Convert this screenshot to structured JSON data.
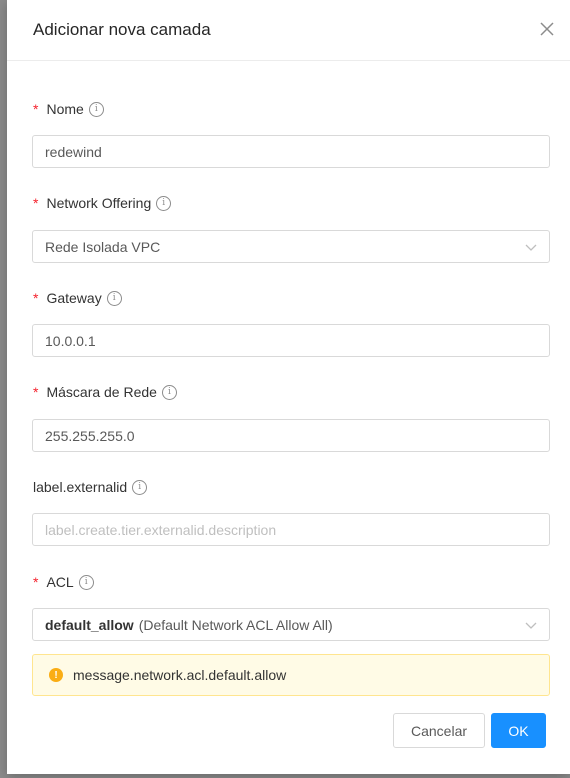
{
  "modal": {
    "title": "Adicionar nova camada",
    "close_icon": "close-icon"
  },
  "fields": {
    "name": {
      "label": "Nome",
      "required": true,
      "value": "redewind"
    },
    "network_offering": {
      "label": "Network Offering",
      "required": true,
      "value": "Rede Isolada VPC"
    },
    "gateway": {
      "label": "Gateway",
      "required": true,
      "value": "10.0.0.1"
    },
    "netmask": {
      "label": "Máscara de Rede",
      "required": true,
      "value": "255.255.255.0"
    },
    "externalid": {
      "label": "label.externalid",
      "required": false,
      "placeholder": "label.create.tier.externalid.description"
    },
    "acl": {
      "label": "ACL",
      "required": true,
      "value_bold": "default_allow",
      "value_rest": "(Default Network ACL Allow All)"
    }
  },
  "alert": {
    "message": "message.network.acl.default.allow",
    "icon": "warning-icon"
  },
  "buttons": {
    "cancel": "Cancelar",
    "ok": "OK"
  },
  "required_marker": "*",
  "colors": {
    "primary": "#1890ff",
    "required": "#f5222d",
    "warning": "#faad14"
  }
}
